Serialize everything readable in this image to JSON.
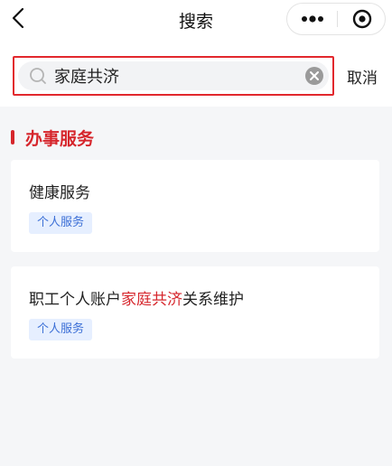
{
  "nav": {
    "title": "搜索"
  },
  "search": {
    "value": "家庭共济",
    "cancel_label": "取消"
  },
  "section": {
    "title": "办事服务"
  },
  "results": [
    {
      "title_before": "健康服务",
      "title_highlight": "",
      "title_after": "",
      "tag": "个人服务"
    },
    {
      "title_before": "职工个人账户",
      "title_highlight": "家庭共济",
      "title_after": "关系维护",
      "tag": "个人服务"
    }
  ],
  "colors": {
    "accent_red": "#d6262c",
    "tag_bg": "#e6efff",
    "tag_text": "#3c6fd6",
    "page_bg": "#f5f6f8"
  }
}
